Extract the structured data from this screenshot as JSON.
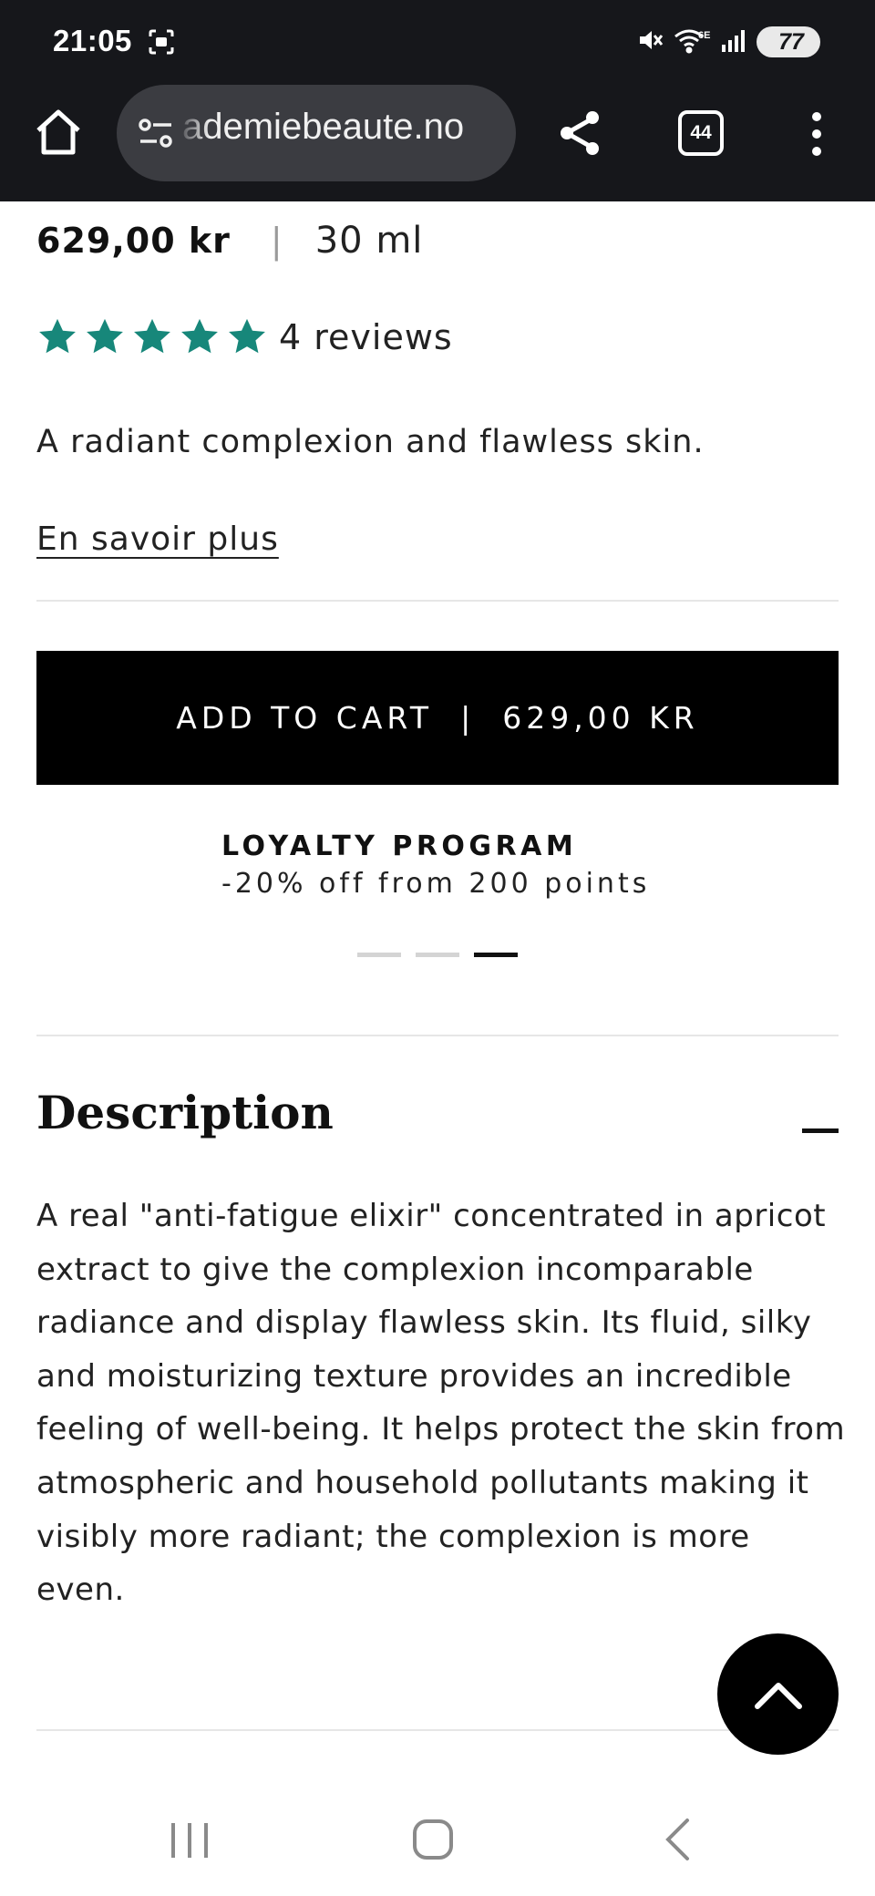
{
  "status_bar": {
    "time": "21:05",
    "battery": "77"
  },
  "browser": {
    "url": "ademiebeaute.no",
    "tab_count": "44"
  },
  "product": {
    "price": "629,00 kr",
    "separator": "|",
    "size": "30 ml",
    "rating": 5,
    "reviews": "4 reviews",
    "tagline": "A radiant complexion and flawless skin.",
    "learn_more": "En savoir plus",
    "add_to_cart": "ADD TO CART",
    "add_to_cart_separator": "|",
    "add_to_cart_price": "629,00 KR"
  },
  "loyalty": {
    "title": "LOYALTY PROGRAM",
    "subtitle": "-20% off from 200 points"
  },
  "description": {
    "heading": "Description",
    "body": "A real \"anti-fatigue elixir\" concentrated in apricot extract to give the complexion incomparable radiance and display flawless skin. Its fluid, silky and moisturizing texture provides an incredible feeling of well-being. It helps protect the skin from atmospheric and household pollutants making it visibly more radiant; the complexion is more even."
  },
  "colors": {
    "star": "#17877a",
    "chrome_bg": "#16171b",
    "button_bg": "#000000"
  },
  "icons": {
    "home": "home-icon",
    "url_settings": "tune-icon",
    "share": "share-icon",
    "menu": "more-vert-icon",
    "collapse": "minus-icon",
    "scroll_top": "chevron-up-icon"
  }
}
